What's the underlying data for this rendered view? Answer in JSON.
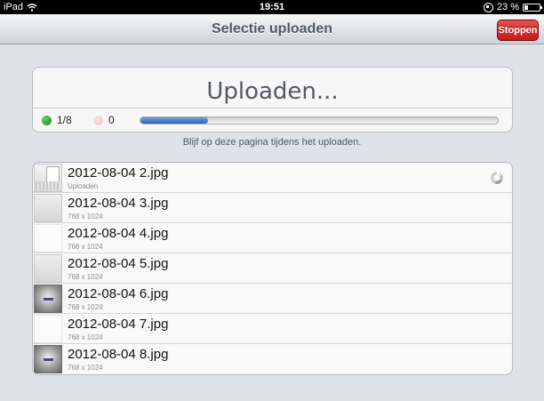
{
  "status_bar": {
    "device": "iPad",
    "time": "19:51",
    "battery": "23 %",
    "battery_level": 0.23,
    "icons": [
      "wifi-icon",
      "rotation-lock-icon",
      "battery-icon"
    ]
  },
  "nav": {
    "title": "Selectie uploaden",
    "stop_label": "Stoppen",
    "stop_color": "#c41a18"
  },
  "upload": {
    "heading": "Uploaden...",
    "done_count": "1/8",
    "failed_count": "0",
    "progress_fraction": 0.19,
    "hint": "Blijf op deze pagina tijdens het uploaden."
  },
  "files": [
    {
      "name": "2012-08-04 2.jpg",
      "sub": "Uploaden",
      "thumb": "doc",
      "uploading": true
    },
    {
      "name": "2012-08-04 3.jpg",
      "sub": "768 x 1024",
      "thumb": "gray"
    },
    {
      "name": "2012-08-04 4.jpg",
      "sub": "768 x 1024",
      "thumb": "blank"
    },
    {
      "name": "2012-08-04 5.jpg",
      "sub": "768 x 1024",
      "thumb": "gray"
    },
    {
      "name": "2012-08-04 6.jpg",
      "sub": "768 x 1024",
      "thumb": "dark"
    },
    {
      "name": "2012-08-04 7.jpg",
      "sub": "768 x 1024",
      "thumb": "blank"
    },
    {
      "name": "2012-08-04 8.jpg",
      "sub": "768 x 1024",
      "thumb": "dark"
    }
  ]
}
